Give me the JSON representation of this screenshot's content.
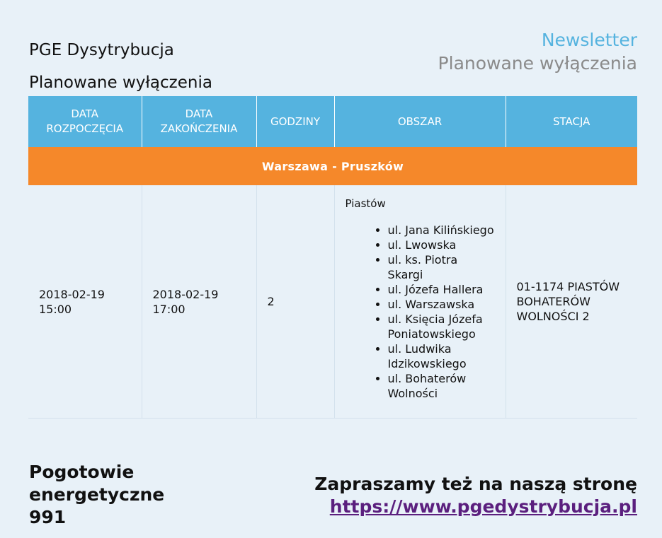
{
  "header": {
    "brand": "PGE Dysytrybucja",
    "title": "Planowane wyłączenia"
  },
  "newsletter": {
    "title": "Newsletter",
    "subtitle": "Planowane wyłączenia"
  },
  "table": {
    "columns": [
      "DATA ROZPOCZĘCIA",
      "DATA ZAKOŃCZENIA",
      "GODZINY",
      "OBSZAR",
      "STACJA"
    ],
    "region": "Warszawa - Pruszków",
    "row": {
      "start": "2018-02-19 15:00",
      "end": "2018-02-19 17:00",
      "hours": "2",
      "area_name": "Piastów",
      "streets": [
        "ul. Jana Kilińskiego",
        "ul. Lwowska",
        "ul. ks. Piotra Skargi",
        "ul. Józefa Hallera",
        "ul. Warszawska",
        "ul. Księcia Józefa Poniatowskiego",
        "ul. Ludwika Idzikowskiego",
        "ul. Bohaterów Wolności"
      ],
      "station": "01-1174 PIASTÓW BOHATERÓW WOLNOŚCI 2"
    }
  },
  "footer": {
    "emergency": "Pogotowie energetyczne 991",
    "invite": "Zapraszamy też na naszą stronę",
    "link": "https://www.pgedystrybucja.pl"
  },
  "colors": {
    "header_bg": "#55b3df",
    "region_bg": "#f5882a",
    "page_bg": "#e8f1f8",
    "link": "#5b1f7e",
    "newsletter_title": "#55b3df"
  }
}
